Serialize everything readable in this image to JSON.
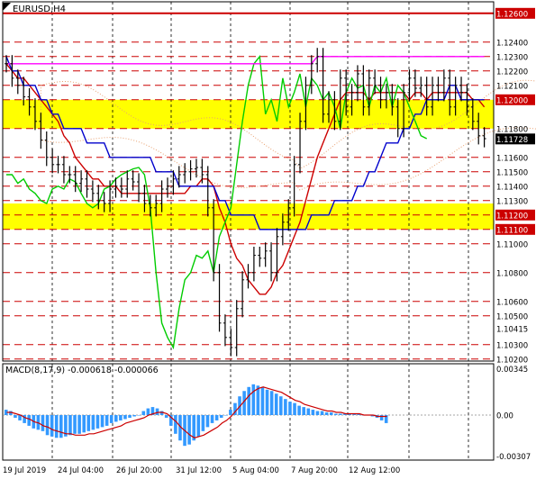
{
  "title": "EURUSD,H4",
  "macd_label": "MACD(8,17,9) -0.000618 -0.000066",
  "colors": {
    "zone": "#ffff00",
    "price_bar": "#000000",
    "level_line": "#cc0000",
    "moving_average_fast": "#cc0000",
    "moving_average_slow": "#0000cc",
    "lagging_line": "#00cc00",
    "upper_line": "#ff00ff",
    "cloud_dots": "#e8a070",
    "macd_histogram": "#3399ff",
    "macd_signal": "#cc0000",
    "grid": "#000000"
  },
  "chart_data": [
    {
      "type": "candlestick",
      "title": "EURUSD,H4",
      "x_ticks": [
        "19 Jul 2019",
        "24 Jul 04:00",
        "26 Jul 20:00",
        "31 Jul 12:00",
        "5 Aug 04:00",
        "7 Aug 20:00",
        "12 Aug 12:00"
      ],
      "y_ticks": [
        1.126,
        1.124,
        1.123,
        1.122,
        1.121,
        1.12,
        1.118,
        1.116,
        1.115,
        1.114,
        1.113,
        1.112,
        1.111,
        1.11,
        1.108,
        1.106,
        1.105,
        1.1041,
        1.103,
        1.102
      ],
      "y_tick_labels": [
        "1.12600",
        "1.12400",
        "1.12300",
        "1.12200",
        "1.12100",
        "1.12000",
        "1.11800",
        "1.11600",
        "1.11500",
        "1.11400",
        "1.11300",
        "1.11200",
        "1.11100",
        "1.11000",
        "1.10800",
        "1.10600",
        "1.10500",
        "1.10415",
        "1.10300",
        "1.10200"
      ],
      "ylim": [
        1.1018,
        1.1268
      ],
      "current_price": 1.11728,
      "current_price_label": "1.11728",
      "highlighted_levels": [
        1.126,
        1.12,
        1.112,
        1.111
      ],
      "support_resistance_levels": [
        1.124,
        1.123,
        1.122,
        1.121,
        1.12,
        1.118,
        1.116,
        1.115,
        1.114,
        1.113,
        1.112,
        1.111,
        1.11,
        1.108,
        1.106,
        1.105,
        1.103,
        1.102
      ],
      "yellow_zones": [
        [
          1.118,
          1.12
        ],
        [
          1.111,
          1.1128
        ]
      ],
      "close_series": [
        1.1225,
        1.1215,
        1.121,
        1.1202,
        1.1195,
        1.1185,
        1.1172,
        1.116,
        1.1155,
        1.1155,
        1.1148,
        1.1148,
        1.1142,
        1.1145,
        1.1138,
        1.1135,
        1.113,
        1.1128,
        1.1138,
        1.114,
        1.1138,
        1.1145,
        1.1143,
        1.1135,
        1.1128,
        1.1125,
        1.1128,
        1.1138,
        1.114,
        1.1145,
        1.1148,
        1.115,
        1.1152,
        1.1153,
        1.1148,
        1.1125,
        1.108,
        1.1045,
        1.1035,
        1.1028,
        1.1055,
        1.1075,
        1.108,
        1.1092,
        1.109,
        1.1095,
        1.108,
        1.1105,
        1.1115,
        1.1125,
        1.1155,
        1.1185,
        1.121,
        1.1225,
        1.123,
        1.119,
        1.12,
        1.1185,
        1.1215,
        1.1195,
        1.1205,
        1.1218,
        1.1195,
        1.1215,
        1.121,
        1.12,
        1.1205,
        1.1195,
        1.118,
        1.1205,
        1.1215,
        1.1208,
        1.121,
        1.1195,
        1.121,
        1.1205,
        1.1215,
        1.1195,
        1.121,
        1.1205,
        1.1195,
        1.1185,
        1.1175,
        1.1173
      ]
    },
    {
      "type": "bar",
      "title": "MACD(8,17,9) -0.000618 -0.000066",
      "y_ticks": [
        0.00345,
        0.0,
        -0.00307
      ],
      "y_tick_labels": [
        "0.00345",
        "0.00",
        "-0.00307"
      ],
      "ylim": [
        -0.0035,
        0.0037
      ],
      "histogram": [
        0.0004,
        0.0003,
        -0.0002,
        -0.0004,
        -0.0006,
        -0.0008,
        -0.001,
        -0.0011,
        -0.0012,
        -0.0015,
        -0.0016,
        -0.0017,
        -0.0017,
        -0.0016,
        -0.0015,
        -0.0014,
        -0.0014,
        -0.0013,
        -0.0012,
        -0.0011,
        -0.001,
        -0.0009,
        -0.0008,
        -0.0006,
        -0.0005,
        -0.0004,
        -0.0003,
        -0.0002,
        -0.0001,
        0.0,
        0.0003,
        0.0005,
        0.0006,
        0.0005,
        0.0003,
        -0.0002,
        -0.0008,
        -0.0014,
        -0.0019,
        -0.0023,
        -0.0022,
        -0.0019,
        -0.0016,
        -0.0012,
        -0.0009,
        -0.0006,
        -0.0004,
        -0.0002,
        0.0,
        0.0004,
        0.0009,
        0.0014,
        0.0018,
        0.0021,
        0.0023,
        0.0022,
        0.0021,
        0.0019,
        0.0018,
        0.0016,
        0.0014,
        0.0012,
        0.001,
        0.0009,
        0.0007,
        0.0006,
        0.0005,
        0.0004,
        0.0003,
        0.0003,
        0.0002,
        0.0002,
        0.0001,
        0.0001,
        0.0001,
        0.0001,
        0.0001,
        0.0001,
        0.0,
        0.0,
        -0.0001,
        -0.0002,
        -0.0004,
        -0.0006
      ],
      "signal": [
        0.0002,
        0.0002,
        0.0001,
        0.0,
        -0.0002,
        -0.0003,
        -0.0005,
        -0.0006,
        -0.0008,
        -0.0009,
        -0.0011,
        -0.0012,
        -0.0013,
        -0.0014,
        -0.0014,
        -0.0015,
        -0.0015,
        -0.0015,
        -0.0014,
        -0.0014,
        -0.0013,
        -0.0012,
        -0.0011,
        -0.001,
        -0.0009,
        -0.0008,
        -0.0006,
        -0.0005,
        -0.0004,
        -0.0003,
        -0.0002,
        0.0,
        0.0001,
        0.0002,
        0.0002,
        0.0001,
        -0.0002,
        -0.0005,
        -0.0009,
        -0.0012,
        -0.0015,
        -0.0017,
        -0.0016,
        -0.0015,
        -0.0013,
        -0.0011,
        -0.0009,
        -0.0006,
        -0.0004,
        -0.0001,
        0.0003,
        0.0007,
        0.0011,
        0.0015,
        0.0018,
        0.002,
        0.0021,
        0.002,
        0.0019,
        0.0018,
        0.0017,
        0.0015,
        0.0013,
        0.0011,
        0.001,
        0.0008,
        0.0007,
        0.0006,
        0.0005,
        0.0004,
        0.0003,
        0.0003,
        0.0002,
        0.0002,
        0.0001,
        0.0001,
        0.0001,
        0.0001,
        0.0,
        0.0,
        0.0,
        -0.0001,
        -0.0001,
        -0.0001
      ]
    }
  ]
}
